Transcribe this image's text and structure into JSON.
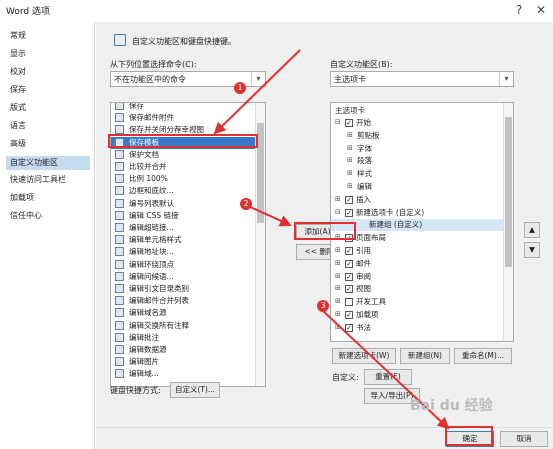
{
  "window": {
    "title": "Word 选项",
    "help": "?",
    "close": "✕"
  },
  "sidebar": {
    "items": [
      "常规",
      "显示",
      "校对",
      "保存",
      "版式",
      "语言",
      "高级",
      "自定义功能区",
      "快速访问工具栏",
      "加载项",
      "信任中心"
    ],
    "selected": "自定义功能区"
  },
  "header": {
    "text": "自定义功能区和键盘快捷键。"
  },
  "left_panel": {
    "choose_label": "从下列位置选择命令(C):",
    "choose_value": "不在功能区中的命令",
    "items": [
      "保存",
      "保存邮件附件",
      "保存并关闭分荐幸视图",
      "保存模板",
      "保护文档",
      "比较并合并",
      "比例 100%",
      "边框和底纹...",
      "编号列表默认",
      "编辑 CSS 链接",
      "编辑超链接...",
      "编辑单元格样式",
      "编辑地址块...",
      "编辑环绕顶点",
      "编辑问候语...",
      "编辑引文目录类别",
      "编辑邮件合并列表",
      "编辑域名源",
      "编辑交换所有注释",
      "编辑批注",
      "编辑数据源",
      "编辑图片",
      "编辑域..."
    ],
    "selected": "保存模板"
  },
  "right_panel": {
    "customize_label": "自定义功能区(B):",
    "customize_value": "主选项卡",
    "tree_header": "主选项卡",
    "tree": [
      {
        "label": "开始",
        "level": 0,
        "exp": "⊟",
        "checked": true
      },
      {
        "label": "剪贴板",
        "level": 1,
        "exp": "⊞",
        "checked": null
      },
      {
        "label": "字体",
        "level": 1,
        "exp": "⊞",
        "checked": null
      },
      {
        "label": "段落",
        "level": 1,
        "exp": "⊞",
        "checked": null
      },
      {
        "label": "样式",
        "level": 1,
        "exp": "⊞",
        "checked": null
      },
      {
        "label": "编辑",
        "level": 1,
        "exp": "⊞",
        "checked": null
      },
      {
        "label": "插入",
        "level": 0,
        "exp": "⊞",
        "checked": true
      },
      {
        "label": "新建选项卡 (自定义)",
        "level": 0,
        "exp": "⊟",
        "checked": true
      },
      {
        "label": "新建组 (自定义)",
        "level": 2,
        "exp": "",
        "checked": null
      },
      {
        "label": "页面布局",
        "level": 0,
        "exp": "⊞",
        "checked": true
      },
      {
        "label": "引用",
        "level": 0,
        "exp": "⊞",
        "checked": true
      },
      {
        "label": "邮件",
        "level": 0,
        "exp": "⊞",
        "checked": true
      },
      {
        "label": "审阅",
        "level": 0,
        "exp": "⊞",
        "checked": true
      },
      {
        "label": "视图",
        "level": 0,
        "exp": "⊞",
        "checked": true
      },
      {
        "label": "开发工具",
        "level": 0,
        "exp": "⊞",
        "checked": false
      },
      {
        "label": "加载项",
        "level": 0,
        "exp": "⊞",
        "checked": true
      },
      {
        "label": "书法",
        "level": 0,
        "exp": "⊞",
        "checked": true
      }
    ],
    "selected": "新建组 (自定义)"
  },
  "buttons": {
    "add": "添加(A) >>",
    "remove": "<< 删除(R)",
    "new_tab": "新建选项卡(W)",
    "new_group": "新建组(N)",
    "rename": "重命名(M)...",
    "customize_label": "自定义:",
    "reset": "重置(E)",
    "import_export": "导入/导出(P)",
    "keyboard_label": "键盘快捷方式:",
    "keyboard_btn": "自定义(T)...",
    "ok": "确定",
    "cancel": "取消"
  },
  "annotations": {
    "badges": [
      "1",
      "2",
      "3"
    ]
  },
  "watermark": "Bai du 经验"
}
